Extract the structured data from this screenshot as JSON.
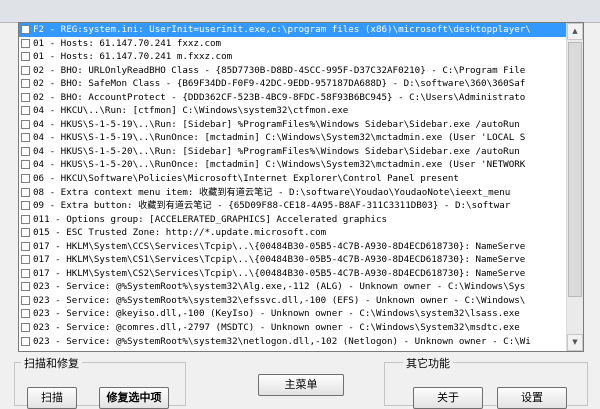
{
  "log": {
    "rows": [
      {
        "text": "F2 - REG:system.ini: UserInit=userinit.exe,c:\\program files (x86)\\microsoft\\desktopplayer\\",
        "selected": true
      },
      {
        "text": "01 - Hosts: 61.147.70.241 fxxz.com"
      },
      {
        "text": "01 - Hosts: 61.147.70.241 m.fxxz.com"
      },
      {
        "text": "02 - BHO: URLOnlyReadBHO Class - {85D7730B-D8BD-4SCC-995F-D37C32AF0210} - C:\\Program File"
      },
      {
        "text": "02 - BHO: SafeMon Class - {B69F34DD-F0F9-42DC-9EDD-957187DA688D} - D:\\software\\360\\360Saf"
      },
      {
        "text": "02 - BHO: AccountProtect - {DDD362CF-523B-4BC9-8FDC-58F93B6BC945} - C:\\Users\\Administrato"
      },
      {
        "text": "04 - HKCU\\..\\Run: [ctfmon] C:\\Windows\\system32\\ctfmon.exe"
      },
      {
        "text": "04 - HKUS\\S-1-5-19\\..\\Run: [Sidebar] %ProgramFiles%\\Windows Sidebar\\Sidebar.exe /autoRun"
      },
      {
        "text": "04 - HKUS\\S-1-5-19\\..\\RunOnce: [mctadmin] C:\\Windows\\System32\\mctadmin.exe (User 'LOCAL S"
      },
      {
        "text": "04 - HKUS\\S-1-5-20\\..\\Run: [Sidebar] %ProgramFiles%\\Windows Sidebar\\Sidebar.exe /autoRun"
      },
      {
        "text": "04 - HKUS\\S-1-5-20\\..\\RunOnce: [mctadmin] C:\\Windows\\System32\\mctadmin.exe (User 'NETWORK"
      },
      {
        "text": "06 - HKCU\\Software\\Policies\\Microsoft\\Internet Explorer\\Control Panel present"
      },
      {
        "text": "08 - Extra context menu item: 收藏到有道云笔记 - D:\\software\\Youdao\\YoudaoNote\\ieext_menu"
      },
      {
        "text": "09 - Extra button: 收藏到有道云笔记 - {65D09F88-CE18-4A95-B8AF-311C3311DB03} - D:\\softwar"
      },
      {
        "text": "011 - Options group: [ACCELERATED_GRAPHICS] Accelerated graphics"
      },
      {
        "text": "015 - ESC Trusted Zone: http://*.update.microsoft.com"
      },
      {
        "text": "017 - HKLM\\System\\CCS\\Services\\Tcpip\\..\\{00484B30-05B5-4C7B-A930-8D4ECD618730}: NameServe"
      },
      {
        "text": "017 - HKLM\\System\\CS1\\Services\\Tcpip\\..\\{00484B30-05B5-4C7B-A930-8D4ECD618730}: NameServe"
      },
      {
        "text": "017 - HKLM\\System\\CS2\\Services\\Tcpip\\..\\{00484B30-05B5-4C7B-A930-8D4ECD618730}: NameServe"
      },
      {
        "text": "023 - Service: @%SystemRoot%\\system32\\Alg.exe,-112 (ALG) - Unknown owner - C:\\Windows\\Sys"
      },
      {
        "text": "023 - Service: @%SystemRoot%\\system32\\efssvc.dll,-100 (EFS) - Unknown owner - C:\\Windows\\"
      },
      {
        "text": "023 - Service: @keyiso.dll,-100 (KeyIso) - Unknown owner - C:\\Windows\\system32\\lsass.exe"
      },
      {
        "text": "023 - Service: @comres.dll,-2797 (MSDTC) - Unknown owner - C:\\Windows\\System32\\msdtc.exe"
      },
      {
        "text": "023 - Service: @%SystemRoot%\\system32\\netlogon.dll,-102 (Netlogon) - Unknown owner - C:\\Wi"
      }
    ]
  },
  "scroll": {
    "up_icon": "▲",
    "down_icon": "▼"
  },
  "scan_group": {
    "title": "扫描和修复",
    "scan_label": "扫描",
    "fix_selected_label": "修复选中项"
  },
  "main_menu_label": "主菜单",
  "other_group": {
    "title": "其它功能",
    "about_label": "关于",
    "settings_label": "设置"
  }
}
